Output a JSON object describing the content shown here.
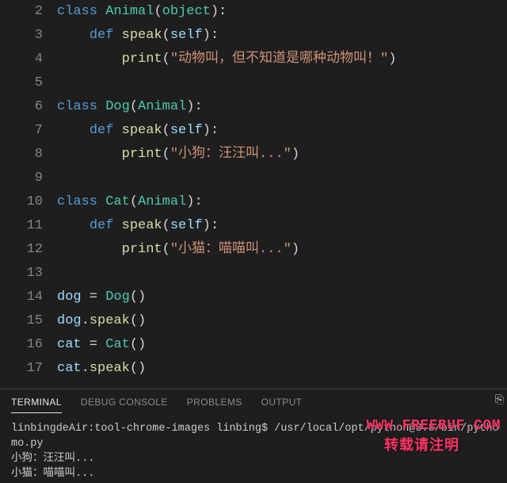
{
  "editor": {
    "lines": [
      {
        "n": 2,
        "seg": [
          [
            "kw",
            "class "
          ],
          [
            "cls",
            "Animal"
          ],
          [
            "pun",
            "("
          ],
          [
            "cls",
            "object"
          ],
          [
            "pun",
            "):"
          ]
        ]
      },
      {
        "n": 3,
        "seg": [
          [
            "",
            "    "
          ],
          [
            "kw",
            "def "
          ],
          [
            "fn",
            "speak"
          ],
          [
            "pun",
            "("
          ],
          [
            "var",
            "self"
          ],
          [
            "pun",
            "):"
          ]
        ]
      },
      {
        "n": 4,
        "seg": [
          [
            "",
            "        "
          ],
          [
            "fn",
            "print"
          ],
          [
            "pun",
            "("
          ],
          [
            "str",
            "\"动物叫，但不知道是哪种动物叫！\""
          ],
          [
            "pun",
            ")"
          ]
        ]
      },
      {
        "n": 5,
        "seg": []
      },
      {
        "n": 6,
        "seg": [
          [
            "kw",
            "class "
          ],
          [
            "cls",
            "Dog"
          ],
          [
            "pun",
            "("
          ],
          [
            "cls",
            "Animal"
          ],
          [
            "pun",
            "):"
          ]
        ]
      },
      {
        "n": 7,
        "seg": [
          [
            "",
            "    "
          ],
          [
            "kw",
            "def "
          ],
          [
            "fn",
            "speak"
          ],
          [
            "pun",
            "("
          ],
          [
            "var",
            "self"
          ],
          [
            "pun",
            "):"
          ]
        ]
      },
      {
        "n": 8,
        "seg": [
          [
            "",
            "        "
          ],
          [
            "fn",
            "print"
          ],
          [
            "pun",
            "("
          ],
          [
            "str",
            "\"小狗：汪汪叫...\""
          ],
          [
            "pun",
            ")"
          ]
        ]
      },
      {
        "n": 9,
        "seg": []
      },
      {
        "n": 10,
        "seg": [
          [
            "kw",
            "class "
          ],
          [
            "cls",
            "Cat"
          ],
          [
            "pun",
            "("
          ],
          [
            "cls",
            "Animal"
          ],
          [
            "pun",
            "):"
          ]
        ]
      },
      {
        "n": 11,
        "seg": [
          [
            "",
            "    "
          ],
          [
            "kw",
            "def "
          ],
          [
            "fn",
            "speak"
          ],
          [
            "pun",
            "("
          ],
          [
            "var",
            "self"
          ],
          [
            "pun",
            "):"
          ]
        ]
      },
      {
        "n": 12,
        "seg": [
          [
            "",
            "        "
          ],
          [
            "fn",
            "print"
          ],
          [
            "pun",
            "("
          ],
          [
            "str",
            "\"小猫：喵喵叫...\""
          ],
          [
            "pun",
            ")"
          ]
        ]
      },
      {
        "n": 13,
        "seg": []
      },
      {
        "n": 14,
        "seg": [
          [
            "var",
            "dog"
          ],
          [
            "op",
            " = "
          ],
          [
            "cls",
            "Dog"
          ],
          [
            "pun",
            "()"
          ]
        ]
      },
      {
        "n": 15,
        "seg": [
          [
            "var",
            "dog"
          ],
          [
            "pun",
            "."
          ],
          [
            "fn",
            "speak"
          ],
          [
            "pun",
            "()"
          ]
        ]
      },
      {
        "n": 16,
        "seg": [
          [
            "var",
            "cat"
          ],
          [
            "op",
            " = "
          ],
          [
            "cls",
            "Cat"
          ],
          [
            "pun",
            "()"
          ]
        ]
      },
      {
        "n": 17,
        "seg": [
          [
            "var",
            "cat"
          ],
          [
            "pun",
            "."
          ],
          [
            "fn",
            "speak"
          ],
          [
            "pun",
            "()"
          ]
        ]
      }
    ]
  },
  "panel": {
    "tabs": {
      "terminal": "TERMINAL",
      "debug": "DEBUG CONSOLE",
      "problems": "PROBLEMS",
      "output": "OUTPUT"
    },
    "active_tab": "terminal",
    "terminal_lines": [
      "linbingdeAir:tool-chrome-images linbing$ /usr/local/opt/python@3.8/bin/pytho",
      "mo.py",
      "小狗：汪汪叫...",
      "小猫：喵喵叫..."
    ]
  },
  "watermark": {
    "line1": "WWW.FREEBUF.COM",
    "line2": "转载请注明"
  }
}
